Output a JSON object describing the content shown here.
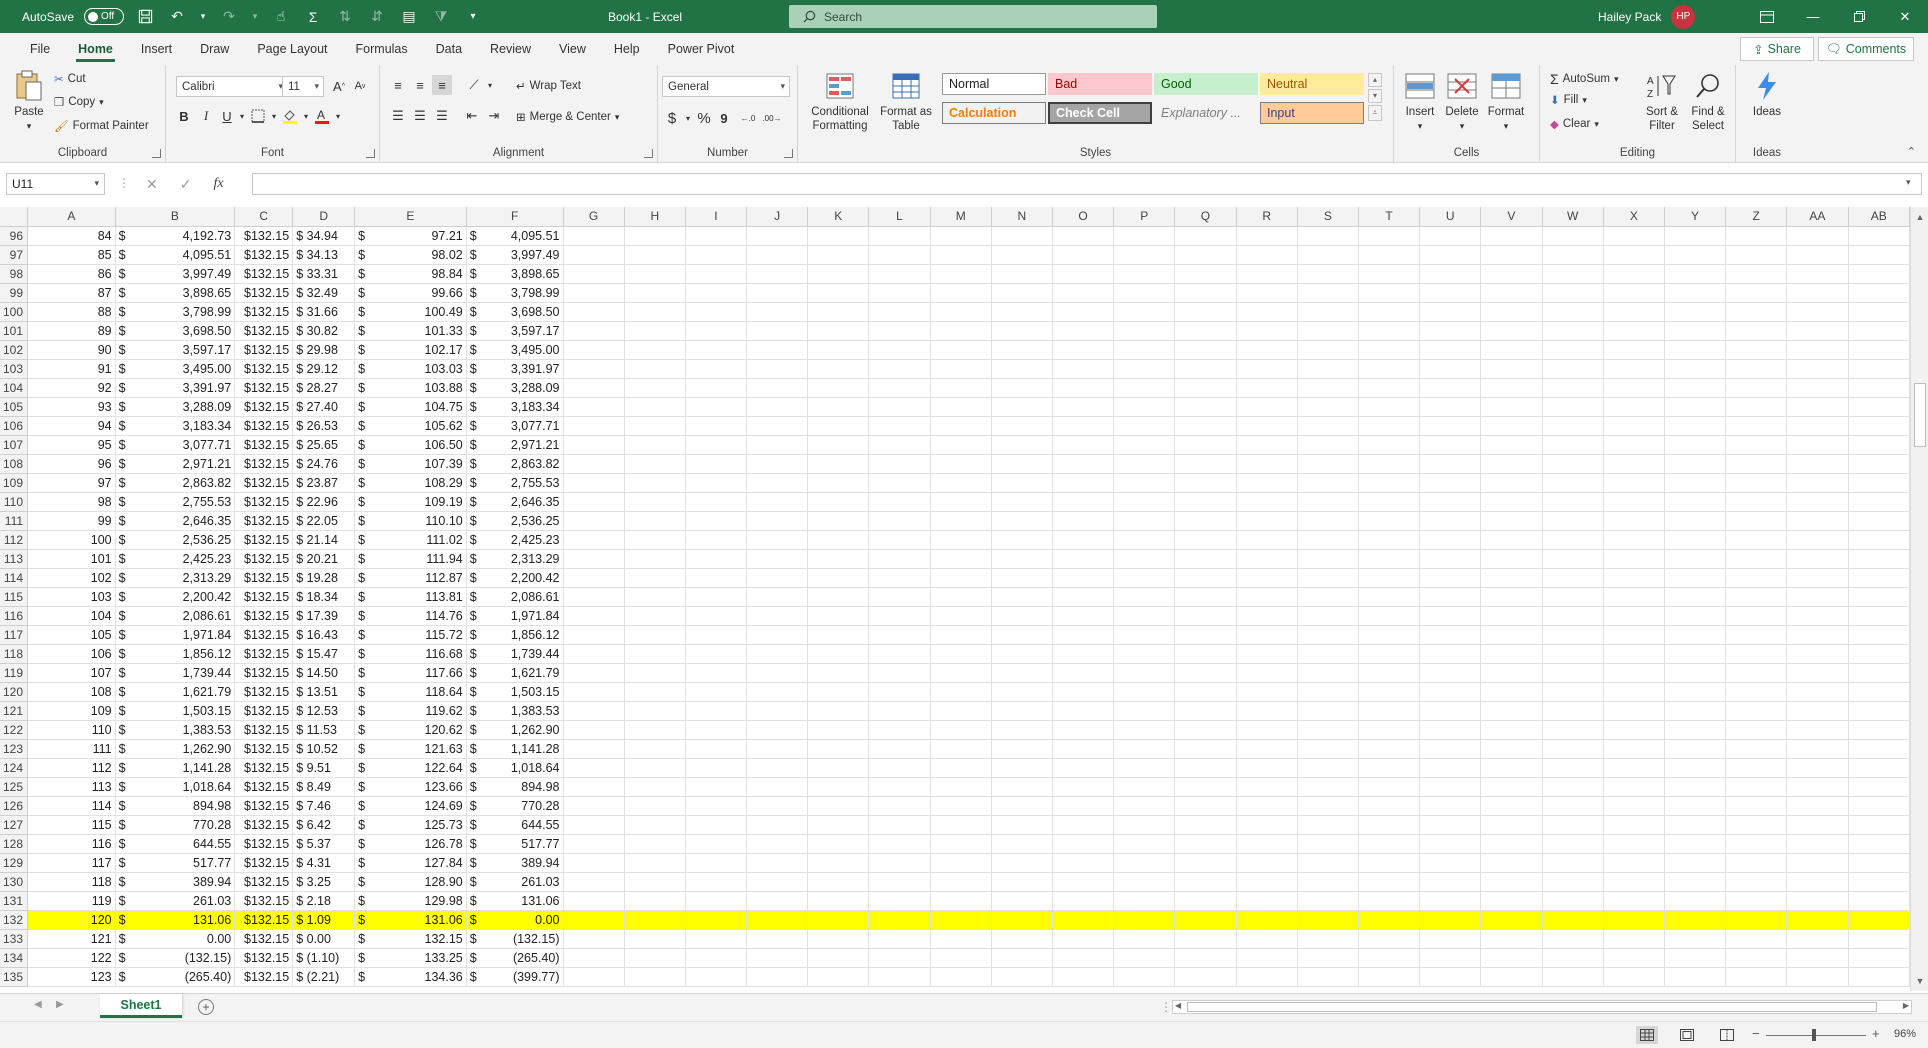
{
  "titlebar": {
    "autosave_label": "AutoSave",
    "autosave_state": "Off",
    "doc_title": "Book1 - Excel",
    "search_placeholder": "Search",
    "user_name": "Hailey Pack",
    "user_initials": "HP"
  },
  "ribbon_tabs": [
    {
      "label": "File"
    },
    {
      "label": "Home"
    },
    {
      "label": "Insert"
    },
    {
      "label": "Draw"
    },
    {
      "label": "Page Layout"
    },
    {
      "label": "Formulas"
    },
    {
      "label": "Data"
    },
    {
      "label": "Review"
    },
    {
      "label": "View"
    },
    {
      "label": "Help"
    },
    {
      "label": "Power Pivot"
    }
  ],
  "share_label": "Share",
  "comments_label": "Comments",
  "clipboard": {
    "paste": "Paste",
    "cut": "Cut",
    "copy": "Copy",
    "format_painter": "Format Painter",
    "label": "Clipboard"
  },
  "font": {
    "name": "Calibri",
    "size": "11",
    "bold": "B",
    "italic": "I",
    "underline": "U",
    "label": "Font"
  },
  "alignment": {
    "wrap_text": "Wrap Text",
    "merge_center": "Merge & Center",
    "label": "Alignment"
  },
  "number": {
    "format": "General",
    "currency": "$",
    "percent": "%",
    "comma": "9",
    "label": "Number"
  },
  "styles": {
    "conditional_line1": "Conditional",
    "conditional_line2": "Formatting",
    "format_table_line1": "Format as",
    "format_table_line2": "Table",
    "normal": "Normal",
    "bad": "Bad",
    "good": "Good",
    "neutral": "Neutral",
    "calculation": "Calculation",
    "check_cell": "Check Cell",
    "explanatory": "Explanatory ...",
    "input": "Input",
    "label": "Styles"
  },
  "cells": {
    "insert": "Insert",
    "delete": "Delete",
    "format": "Format",
    "label": "Cells"
  },
  "editing": {
    "autosum": "AutoSum",
    "fill": "Fill",
    "clear": "Clear",
    "sort_line1": "Sort &",
    "sort_line2": "Filter",
    "find_line1": "Find &",
    "find_line2": "Select",
    "label": "Editing"
  },
  "ideas": {
    "button": "Ideas",
    "label": "Ideas"
  },
  "formula_bar": {
    "name_box": "U11",
    "fx": "fx",
    "formula": ""
  },
  "columns": [
    "A",
    "B",
    "C",
    "D",
    "E",
    "F",
    "G",
    "H",
    "I",
    "J",
    "K",
    "L",
    "M",
    "N",
    "O",
    "P",
    "Q",
    "R",
    "S",
    "T",
    "U",
    "V",
    "W",
    "X",
    "Y",
    "Z",
    "AA",
    "AB"
  ],
  "rows": [
    {
      "r": "96",
      "a": "84",
      "b": "4,192.73",
      "c": "$132.15",
      "d": "$ 34.94",
      "e": "97.21",
      "f": "4,095.51"
    },
    {
      "r": "97",
      "a": "85",
      "b": "4,095.51",
      "c": "$132.15",
      "d": "$ 34.13",
      "e": "98.02",
      "f": "3,997.49"
    },
    {
      "r": "98",
      "a": "86",
      "b": "3,997.49",
      "c": "$132.15",
      "d": "$ 33.31",
      "e": "98.84",
      "f": "3,898.65"
    },
    {
      "r": "99",
      "a": "87",
      "b": "3,898.65",
      "c": "$132.15",
      "d": "$ 32.49",
      "e": "99.66",
      "f": "3,798.99"
    },
    {
      "r": "100",
      "a": "88",
      "b": "3,798.99",
      "c": "$132.15",
      "d": "$ 31.66",
      "e": "100.49",
      "f": "3,698.50"
    },
    {
      "r": "101",
      "a": "89",
      "b": "3,698.50",
      "c": "$132.15",
      "d": "$ 30.82",
      "e": "101.33",
      "f": "3,597.17"
    },
    {
      "r": "102",
      "a": "90",
      "b": "3,597.17",
      "c": "$132.15",
      "d": "$ 29.98",
      "e": "102.17",
      "f": "3,495.00"
    },
    {
      "r": "103",
      "a": "91",
      "b": "3,495.00",
      "c": "$132.15",
      "d": "$ 29.12",
      "e": "103.03",
      "f": "3,391.97"
    },
    {
      "r": "104",
      "a": "92",
      "b": "3,391.97",
      "c": "$132.15",
      "d": "$ 28.27",
      "e": "103.88",
      "f": "3,288.09"
    },
    {
      "r": "105",
      "a": "93",
      "b": "3,288.09",
      "c": "$132.15",
      "d": "$ 27.40",
      "e": "104.75",
      "f": "3,183.34"
    },
    {
      "r": "106",
      "a": "94",
      "b": "3,183.34",
      "c": "$132.15",
      "d": "$ 26.53",
      "e": "105.62",
      "f": "3,077.71"
    },
    {
      "r": "107",
      "a": "95",
      "b": "3,077.71",
      "c": "$132.15",
      "d": "$ 25.65",
      "e": "106.50",
      "f": "2,971.21"
    },
    {
      "r": "108",
      "a": "96",
      "b": "2,971.21",
      "c": "$132.15",
      "d": "$ 24.76",
      "e": "107.39",
      "f": "2,863.82"
    },
    {
      "r": "109",
      "a": "97",
      "b": "2,863.82",
      "c": "$132.15",
      "d": "$ 23.87",
      "e": "108.29",
      "f": "2,755.53"
    },
    {
      "r": "110",
      "a": "98",
      "b": "2,755.53",
      "c": "$132.15",
      "d": "$ 22.96",
      "e": "109.19",
      "f": "2,646.35"
    },
    {
      "r": "111",
      "a": "99",
      "b": "2,646.35",
      "c": "$132.15",
      "d": "$ 22.05",
      "e": "110.10",
      "f": "2,536.25"
    },
    {
      "r": "112",
      "a": "100",
      "b": "2,536.25",
      "c": "$132.15",
      "d": "$ 21.14",
      "e": "111.02",
      "f": "2,425.23"
    },
    {
      "r": "113",
      "a": "101",
      "b": "2,425.23",
      "c": "$132.15",
      "d": "$ 20.21",
      "e": "111.94",
      "f": "2,313.29"
    },
    {
      "r": "114",
      "a": "102",
      "b": "2,313.29",
      "c": "$132.15",
      "d": "$ 19.28",
      "e": "112.87",
      "f": "2,200.42"
    },
    {
      "r": "115",
      "a": "103",
      "b": "2,200.42",
      "c": "$132.15",
      "d": "$ 18.34",
      "e": "113.81",
      "f": "2,086.61"
    },
    {
      "r": "116",
      "a": "104",
      "b": "2,086.61",
      "c": "$132.15",
      "d": "$ 17.39",
      "e": "114.76",
      "f": "1,971.84"
    },
    {
      "r": "117",
      "a": "105",
      "b": "1,971.84",
      "c": "$132.15",
      "d": "$ 16.43",
      "e": "115.72",
      "f": "1,856.12"
    },
    {
      "r": "118",
      "a": "106",
      "b": "1,856.12",
      "c": "$132.15",
      "d": "$ 15.47",
      "e": "116.68",
      "f": "1,739.44"
    },
    {
      "r": "119",
      "a": "107",
      "b": "1,739.44",
      "c": "$132.15",
      "d": "$ 14.50",
      "e": "117.66",
      "f": "1,621.79"
    },
    {
      "r": "120",
      "a": "108",
      "b": "1,621.79",
      "c": "$132.15",
      "d": "$ 13.51",
      "e": "118.64",
      "f": "1,503.15"
    },
    {
      "r": "121",
      "a": "109",
      "b": "1,503.15",
      "c": "$132.15",
      "d": "$ 12.53",
      "e": "119.62",
      "f": "1,383.53"
    },
    {
      "r": "122",
      "a": "110",
      "b": "1,383.53",
      "c": "$132.15",
      "d": "$ 11.53",
      "e": "120.62",
      "f": "1,262.90"
    },
    {
      "r": "123",
      "a": "111",
      "b": "1,262.90",
      "c": "$132.15",
      "d": "$ 10.52",
      "e": "121.63",
      "f": "1,141.28"
    },
    {
      "r": "124",
      "a": "112",
      "b": "1,141.28",
      "c": "$132.15",
      "d": "$ 9.51",
      "e": "122.64",
      "f": "1,018.64"
    },
    {
      "r": "125",
      "a": "113",
      "b": "1,018.64",
      "c": "$132.15",
      "d": "$ 8.49",
      "e": "123.66",
      "f": "894.98"
    },
    {
      "r": "126",
      "a": "114",
      "b": "894.98",
      "c": "$132.15",
      "d": "$ 7.46",
      "e": "124.69",
      "f": "770.28"
    },
    {
      "r": "127",
      "a": "115",
      "b": "770.28",
      "c": "$132.15",
      "d": "$ 6.42",
      "e": "125.73",
      "f": "644.55"
    },
    {
      "r": "128",
      "a": "116",
      "b": "644.55",
      "c": "$132.15",
      "d": "$ 5.37",
      "e": "126.78",
      "f": "517.77"
    },
    {
      "r": "129",
      "a": "117",
      "b": "517.77",
      "c": "$132.15",
      "d": "$ 4.31",
      "e": "127.84",
      "f": "389.94"
    },
    {
      "r": "130",
      "a": "118",
      "b": "389.94",
      "c": "$132.15",
      "d": "$ 3.25",
      "e": "128.90",
      "f": "261.03"
    },
    {
      "r": "131",
      "a": "119",
      "b": "261.03",
      "c": "$132.15",
      "d": "$ 2.18",
      "e": "129.98",
      "f": "131.06"
    },
    {
      "r": "132",
      "a": "120",
      "b": "131.06",
      "c": "$132.15",
      "d": "$ 1.09",
      "e": "131.06",
      "f": "0.00",
      "highlight": true
    },
    {
      "r": "133",
      "a": "121",
      "b": "0.00",
      "c": "$132.15",
      "d": "$ 0.00",
      "e": "132.15",
      "f": "(132.15)"
    },
    {
      "r": "134",
      "a": "122",
      "b": "(132.15)",
      "c": "$132.15",
      "d": "$ (1.10)",
      "e": "133.25",
      "f": "(265.40)"
    },
    {
      "r": "135",
      "a": "123",
      "b": "(265.40)",
      "c": "$132.15",
      "d": "$ (2.21)",
      "e": "134.36",
      "f": "(399.77)"
    }
  ],
  "dollar_sign": "$",
  "sheet_tab": "Sheet1",
  "add_sheet": "+",
  "zoom_level": "96%",
  "colors": {
    "excel_green": "#217346",
    "highlight": "#ffff00"
  }
}
